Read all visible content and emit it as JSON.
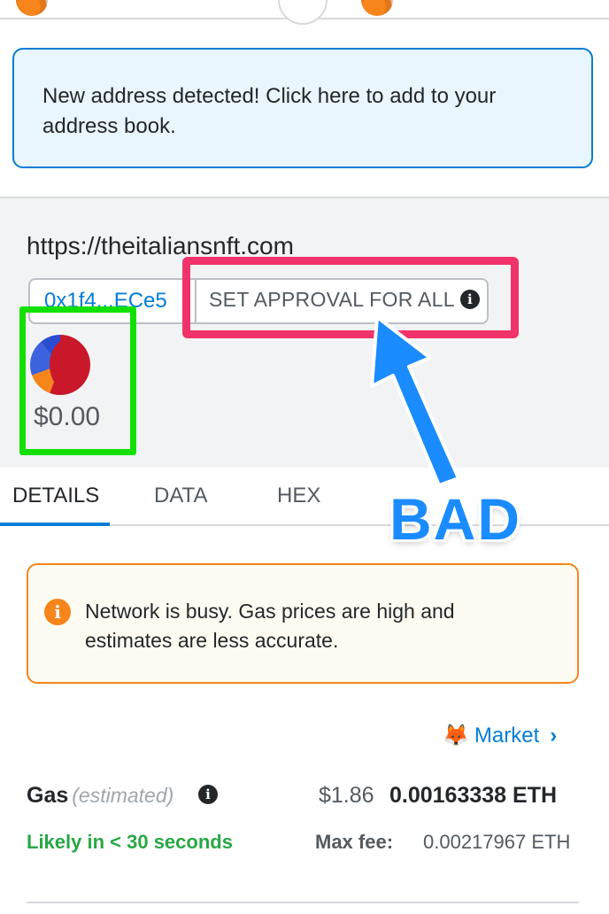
{
  "notice": {
    "text": "New address detected! Click here to add to your address book."
  },
  "origin": {
    "url": "https://theitaliansnft.com",
    "contract_address": "0x1f4...ECe5",
    "method": "SET APPROVAL FOR ALL",
    "amount": "$0.00"
  },
  "annotation": {
    "label": "BAD",
    "arrow_color": "#1a8cff",
    "red_box_color": "#f2336b",
    "green_box_color": "#11e000"
  },
  "tabs": [
    {
      "label": "DETAILS",
      "active": true
    },
    {
      "label": "DATA",
      "active": false
    },
    {
      "label": "HEX",
      "active": false
    }
  ],
  "warning": {
    "text": "Network is busy. Gas prices are high and estimates are less accurate.",
    "icon": "info-icon"
  },
  "market": {
    "label": "Market",
    "icon": "fox-icon"
  },
  "gas": {
    "label": "Gas",
    "estimated_label": "(estimated)",
    "fiat": "$1.86",
    "eth": "0.00163338 ETH",
    "likely": "Likely in < 30 seconds",
    "max_fee_label": "Max fee:",
    "max_fee_value": "0.00217967 ETH"
  },
  "colors": {
    "primary_blue": "#037dd6",
    "warning_orange": "#f6851b",
    "success_green": "#28a745"
  }
}
